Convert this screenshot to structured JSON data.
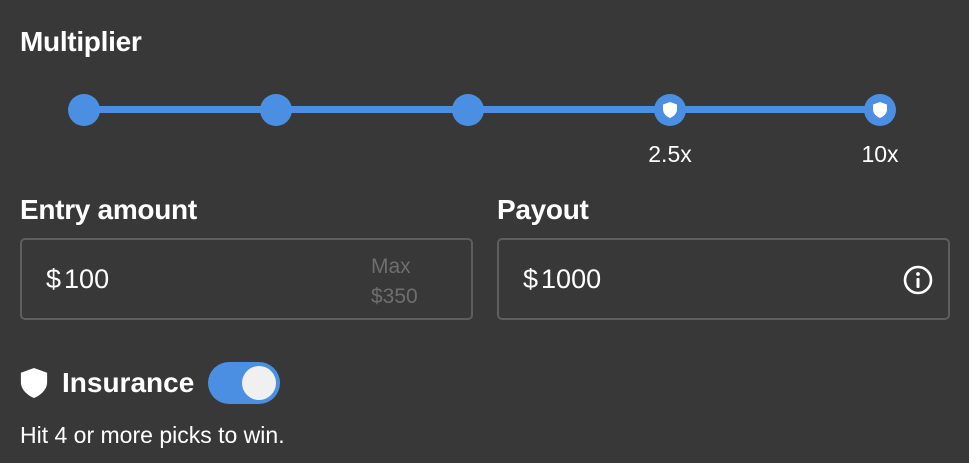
{
  "multiplier": {
    "title": "Multiplier",
    "stops": [
      {
        "has_shield": false,
        "label": ""
      },
      {
        "has_shield": false,
        "label": ""
      },
      {
        "has_shield": false,
        "label": ""
      },
      {
        "has_shield": true,
        "label": "2.5x"
      },
      {
        "has_shield": true,
        "label": "10x"
      }
    ]
  },
  "entry": {
    "title": "Entry amount",
    "currency": "$",
    "value": "100",
    "max_label": "Max",
    "max_value": "$350"
  },
  "payout": {
    "title": "Payout",
    "currency": "$",
    "value": "1000",
    "info_icon": "info-icon"
  },
  "insurance": {
    "label": "Insurance",
    "enabled": true,
    "hint": "Hit 4 or more picks to win."
  },
  "colors": {
    "accent": "#4a8fe2",
    "background": "#383838",
    "border": "#5e5e5e",
    "muted_text": "#6e6e6e"
  }
}
